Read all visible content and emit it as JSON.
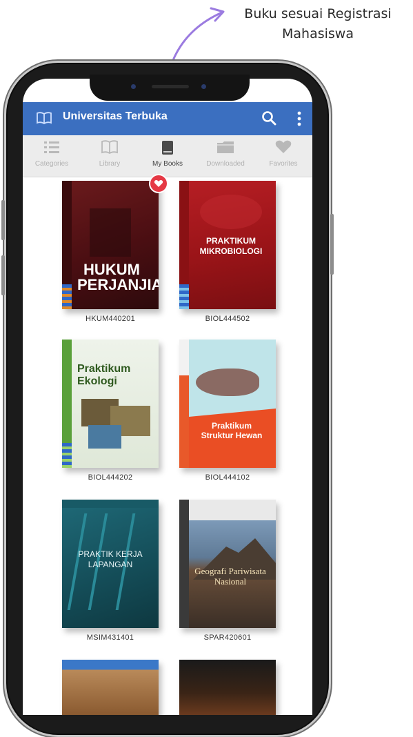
{
  "annotation": {
    "line1": "Buku sesuai Registrasi",
    "line2": "Mahasiswa"
  },
  "app": {
    "title": "Universitas Terbuka",
    "bar_color": "#3b6fc0"
  },
  "tabs": [
    {
      "label": "Categories",
      "icon": "list-icon",
      "active": false
    },
    {
      "label": "Library",
      "icon": "open-book-icon",
      "active": false
    },
    {
      "label": "My Books",
      "icon": "book-icon",
      "active": true
    },
    {
      "label": "Downloaded",
      "icon": "folder-icon",
      "active": false
    },
    {
      "label": "Favorites",
      "icon": "heart-icon",
      "active": false
    }
  ],
  "books": [
    {
      "code": "HKUM440201",
      "cover_title": "HUKUM PERJANJIAN",
      "favorite": true
    },
    {
      "code": "BIOL444502",
      "cover_title": "PRAKTIKUM MIKROBIOLOGI",
      "favorite": false
    },
    {
      "code": "BIOL444202",
      "cover_title": "Praktikum Ekologi",
      "favorite": false
    },
    {
      "code": "BIOL444102",
      "cover_title": "Praktikum Struktur Hewan",
      "favorite": false
    },
    {
      "code": "MSIM431401",
      "cover_title": "PRAKTIK KERJA LAPANGAN",
      "favorite": false
    },
    {
      "code": "SPAR420601",
      "cover_title": "Geografi Pariwisata Nasional",
      "favorite": false
    }
  ]
}
